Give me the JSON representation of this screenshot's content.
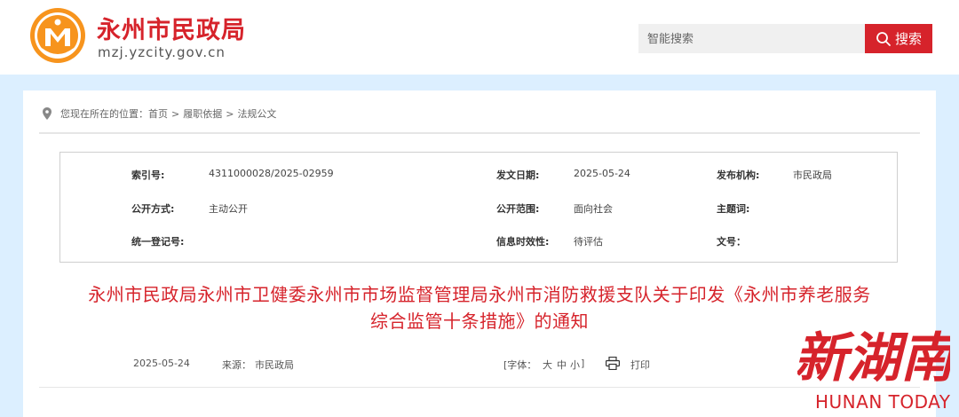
{
  "header": {
    "site_name": "永州市民政局",
    "site_domain": "mzj.yzcity.gov.cn",
    "logo_icon": "yongzhou-civil-affairs-emblem",
    "search_placeholder": "智能搜索",
    "search_button_label": "搜索",
    "brand_color": "#d6232b"
  },
  "breadcrumb": {
    "prefix": "您现在所在的位置：",
    "items": [
      "首页",
      "履职依据",
      "法规公文"
    ],
    "separator": ">"
  },
  "meta": {
    "index_no_label": "索引号:",
    "index_no": "4311000028/2025-02959",
    "issue_date_label": "发文日期:",
    "issue_date": "2025-05-24",
    "publisher_label": "发布机构:",
    "publisher": "市民政局",
    "disclosure_label": "公开方式:",
    "disclosure": "主动公开",
    "scope_label": "公开范围:",
    "scope": "面向社会",
    "topic_label": "主题词:",
    "topic": "",
    "reg_no_label": "统一登记号:",
    "reg_no": "",
    "validity_label": "信息时效性:",
    "validity": "待评估",
    "doc_no_label": "文号：",
    "doc_no": ""
  },
  "article": {
    "title_line1": "永州市民政局永州市卫健委永州市市场监督管理局永州市消防救援支队关于印发《永州市养老服务",
    "title_line2": "综合监管十条措施》的通知",
    "date": "2025-05-24",
    "source_label": "来源：",
    "source": "市民政局",
    "font_label": "[字体：",
    "font_large": "大",
    "font_medium": "中",
    "font_small": "小",
    "font_close": "]",
    "print_label": "打印"
  },
  "watermark": {
    "art_text": "新湖南",
    "text": "HUNAN TODAY"
  }
}
